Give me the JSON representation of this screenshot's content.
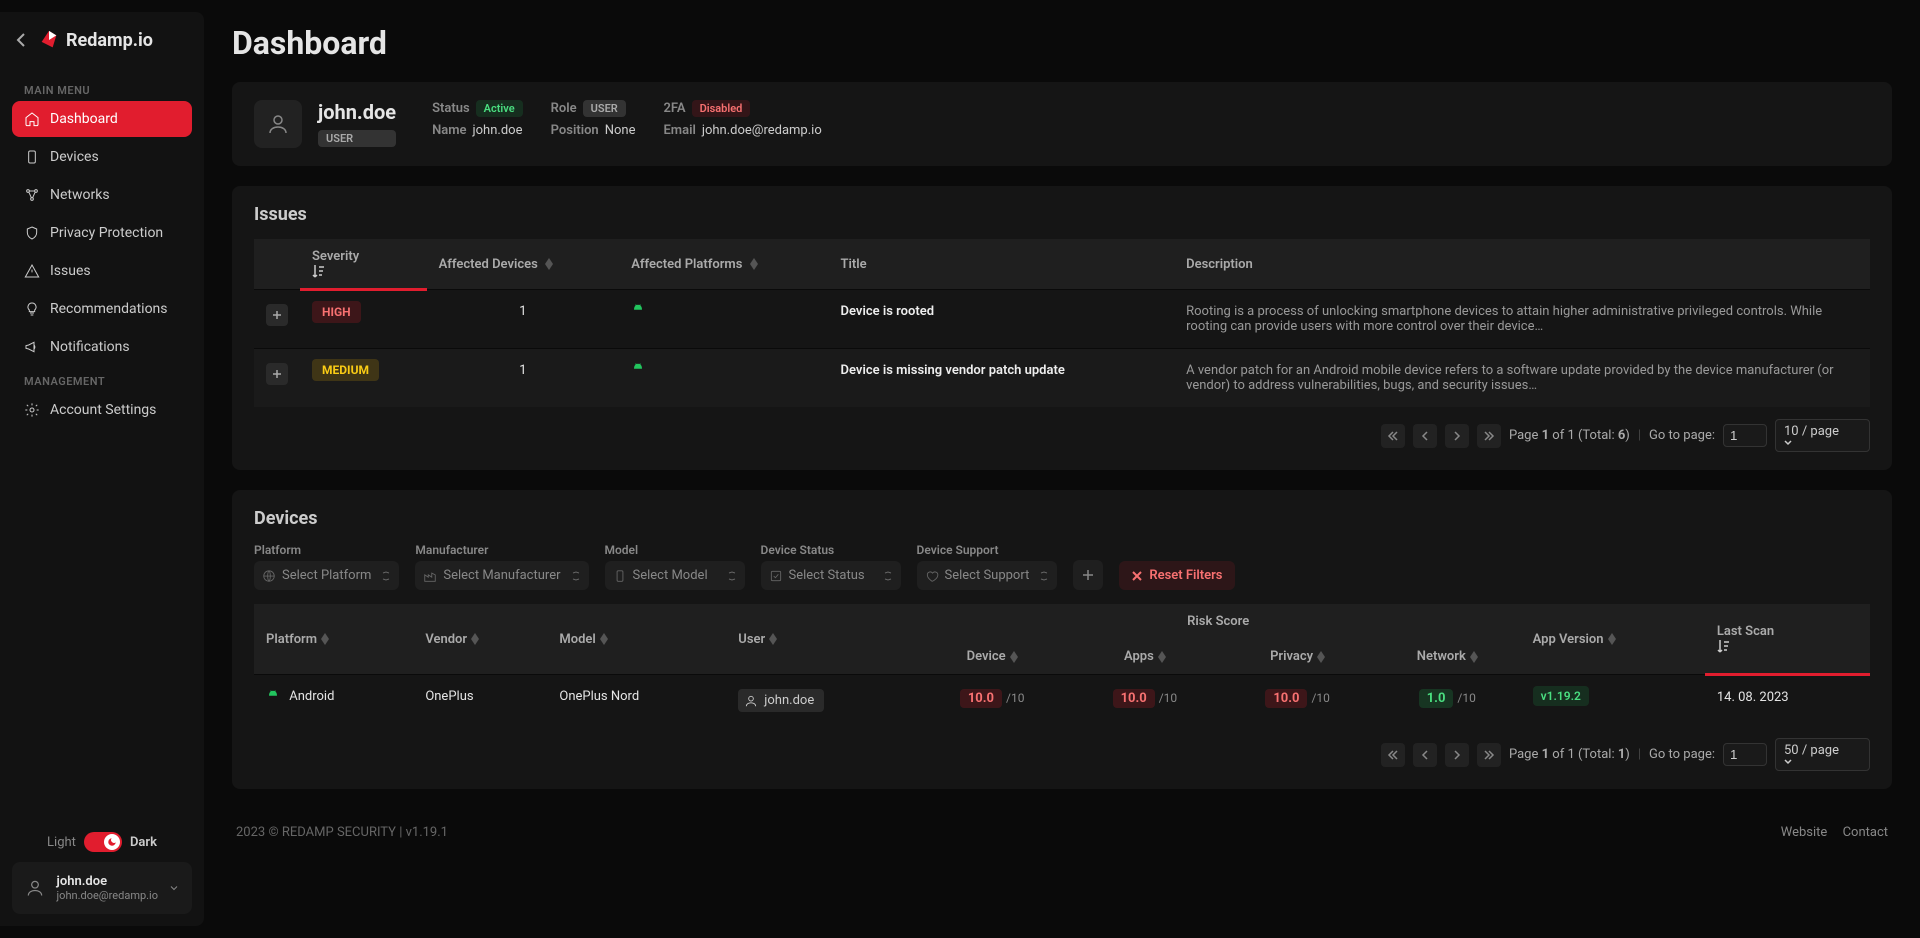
{
  "brand": "Redamp.io",
  "page_title": "Dashboard",
  "sidebar": {
    "main_label": "MAIN MENU",
    "management_label": "MANAGEMENT",
    "items": [
      {
        "label": "Dashboard",
        "active": true
      },
      {
        "label": "Devices"
      },
      {
        "label": "Networks"
      },
      {
        "label": "Privacy Protection"
      },
      {
        "label": "Issues"
      },
      {
        "label": "Recommendations"
      },
      {
        "label": "Notifications"
      }
    ],
    "mgmt_items": [
      {
        "label": "Account Settings"
      }
    ],
    "theme": {
      "light": "Light",
      "dark": "Dark"
    },
    "user": {
      "name": "john.doe",
      "email": "john.doe@redamp.io"
    }
  },
  "user_panel": {
    "username": "john.doe",
    "role_badge": "USER",
    "fields": {
      "status_label": "Status",
      "status_value": "Active",
      "role_label": "Role",
      "role_value": "USER",
      "twofa_label": "2FA",
      "twofa_value": "Disabled",
      "name_label": "Name",
      "name_value": "john.doe",
      "position_label": "Position",
      "position_value": "None",
      "email_label": "Email",
      "email_value": "john.doe@redamp.io"
    }
  },
  "issues": {
    "title": "Issues",
    "columns": {
      "severity": "Severity",
      "affected_devices": "Affected Devices",
      "affected_platforms": "Affected Platforms",
      "title": "Title",
      "description": "Description"
    },
    "rows": [
      {
        "severity": "HIGH",
        "devices": "1",
        "title": "Device is rooted",
        "desc": "Rooting is a process of unlocking smartphone devices to attain higher administrative privileged controls. While rooting can provide users with more control over their device…"
      },
      {
        "severity": "MEDIUM",
        "devices": "1",
        "title": "Device is missing vendor patch update",
        "desc": "A vendor patch for an Android mobile device refers to a software update provided by the device manufacturer (or vendor) to address vulnerabilities, bugs, and security issues…"
      }
    ],
    "pagination": {
      "text_prefix": "Page ",
      "page": "1",
      "of": " of 1 (Total: ",
      "total": "6",
      "suffix": ")",
      "goto": "Go to page:",
      "goto_value": "1",
      "per_page": "10 / page"
    }
  },
  "devices": {
    "title": "Devices",
    "filters": {
      "platform": {
        "label": "Platform",
        "placeholder": "Select Platform"
      },
      "manufacturer": {
        "label": "Manufacturer",
        "placeholder": "Select Manufacturer"
      },
      "model": {
        "label": "Model",
        "placeholder": "Select Model"
      },
      "status": {
        "label": "Device Status",
        "placeholder": "Select Status"
      },
      "support": {
        "label": "Device Support",
        "placeholder": "Select Support"
      },
      "reset": "Reset Filters"
    },
    "columns": {
      "platform": "Platform",
      "vendor": "Vendor",
      "model": "Model",
      "user": "User",
      "risk": "Risk Score",
      "device": "Device",
      "apps": "Apps",
      "privacy": "Privacy",
      "network": "Network",
      "version": "App Version",
      "last_scan": "Last Scan"
    },
    "rows": [
      {
        "platform": "Android",
        "vendor": "OnePlus",
        "model": "OnePlus Nord",
        "user": "john.doe",
        "device": "10.0",
        "apps": "10.0",
        "privacy": "10.0",
        "network": "1.0",
        "version": "v1.19.2",
        "last_scan": "14. 08. 2023"
      }
    ],
    "score_sub": "/10",
    "pagination": {
      "text_prefix": "Page ",
      "page": "1",
      "of": " of 1 (Total: ",
      "total": "1",
      "suffix": ")",
      "goto": "Go to page:",
      "goto_value": "1",
      "per_page": "50 / page"
    }
  },
  "footer": {
    "copyright": "2023 © REDAMP SECURITY | v1.19.1",
    "website": "Website",
    "contact": "Contact"
  }
}
